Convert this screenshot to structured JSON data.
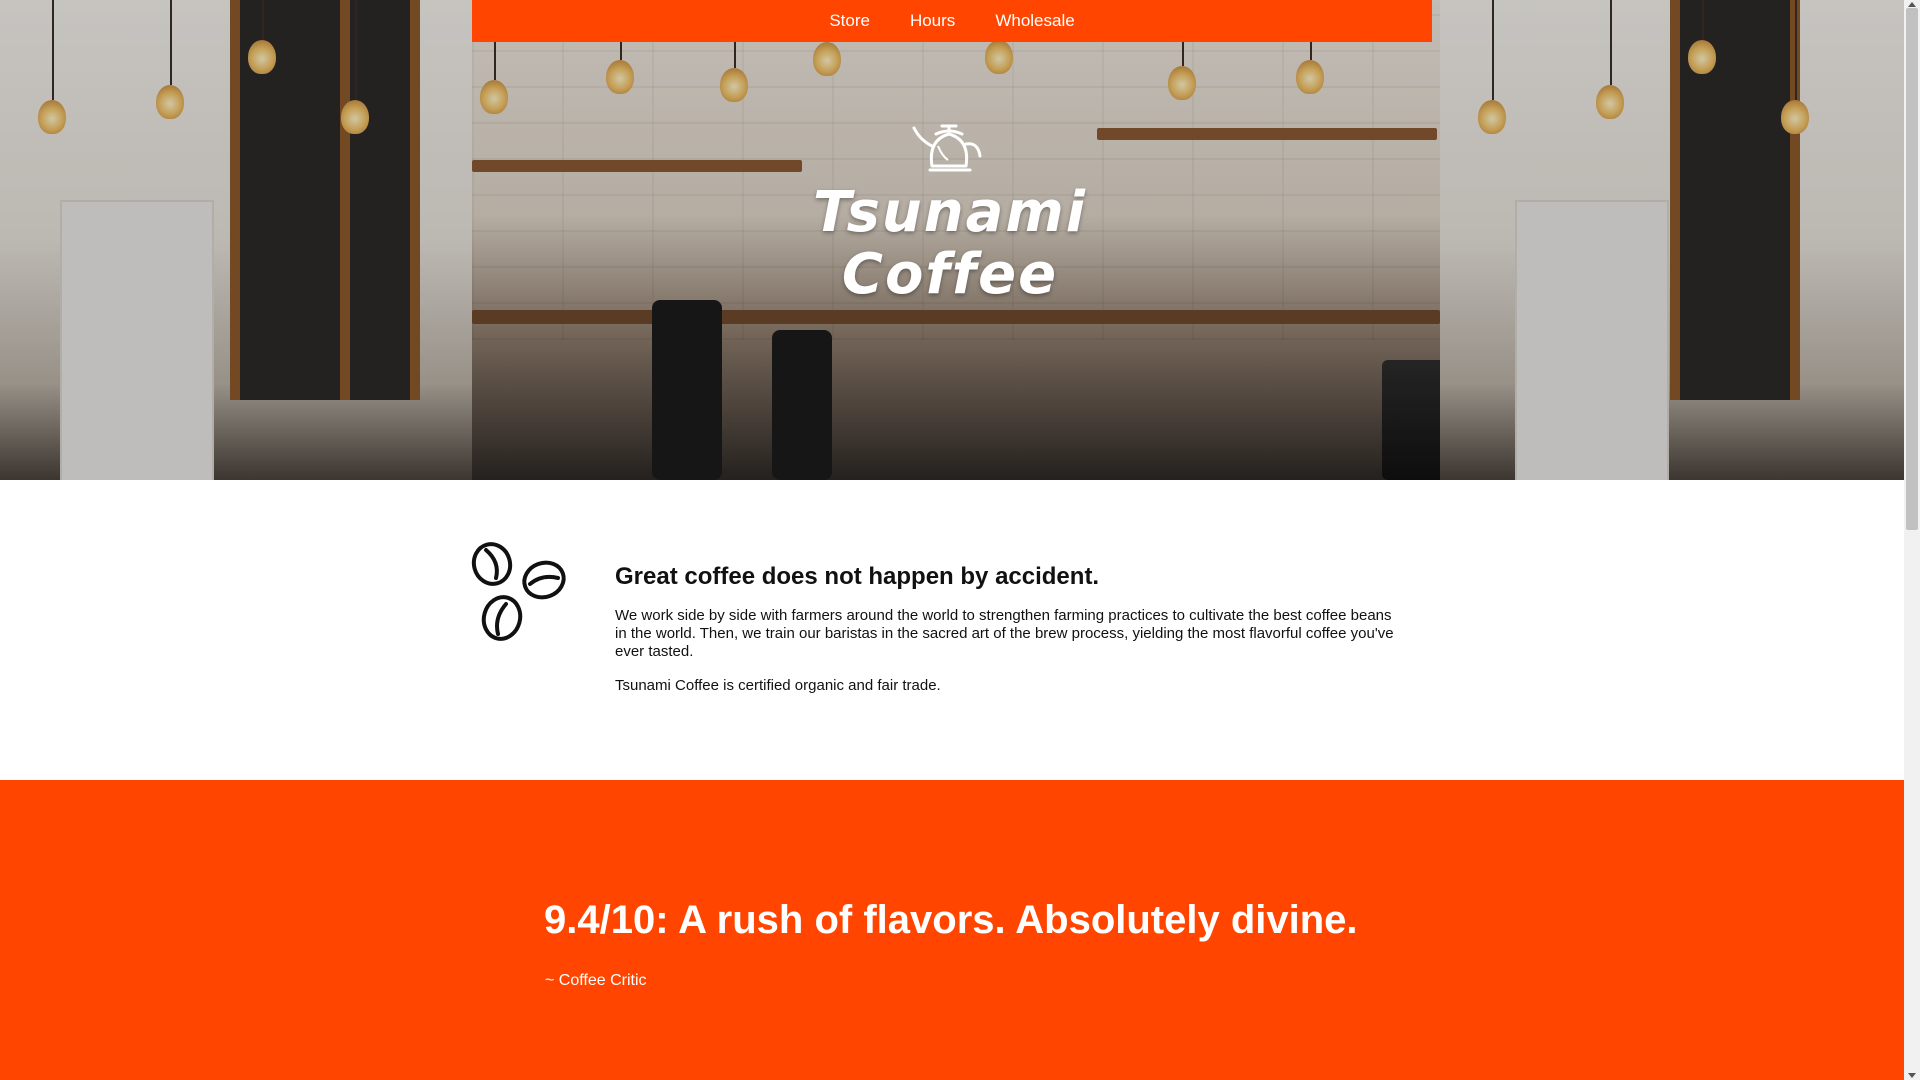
{
  "nav": {
    "items": [
      {
        "label": "Store"
      },
      {
        "label": "Hours"
      },
      {
        "label": "Wholesale"
      }
    ]
  },
  "brand": {
    "line1": "Tsunami",
    "line2": "Coffee",
    "accent": "#ff4500"
  },
  "about": {
    "heading": "Great coffee does not happen by accident.",
    "paragraph1": "We work side by side with farmers around the world to strengthen farming practices to cultivate the best coffee beans in the world. Then, we train our baristas in the sacred art of the brew process, yielding the most flavorful coffee you've ever tasted.",
    "paragraph2": "Tsunami Coffee is certified organic and fair trade.",
    "icon": "coffee-beans-icon"
  },
  "quote": {
    "text": "9.4/10: A rush of flavors. Absolutely divine.",
    "author": "~ Coffee Critic"
  }
}
